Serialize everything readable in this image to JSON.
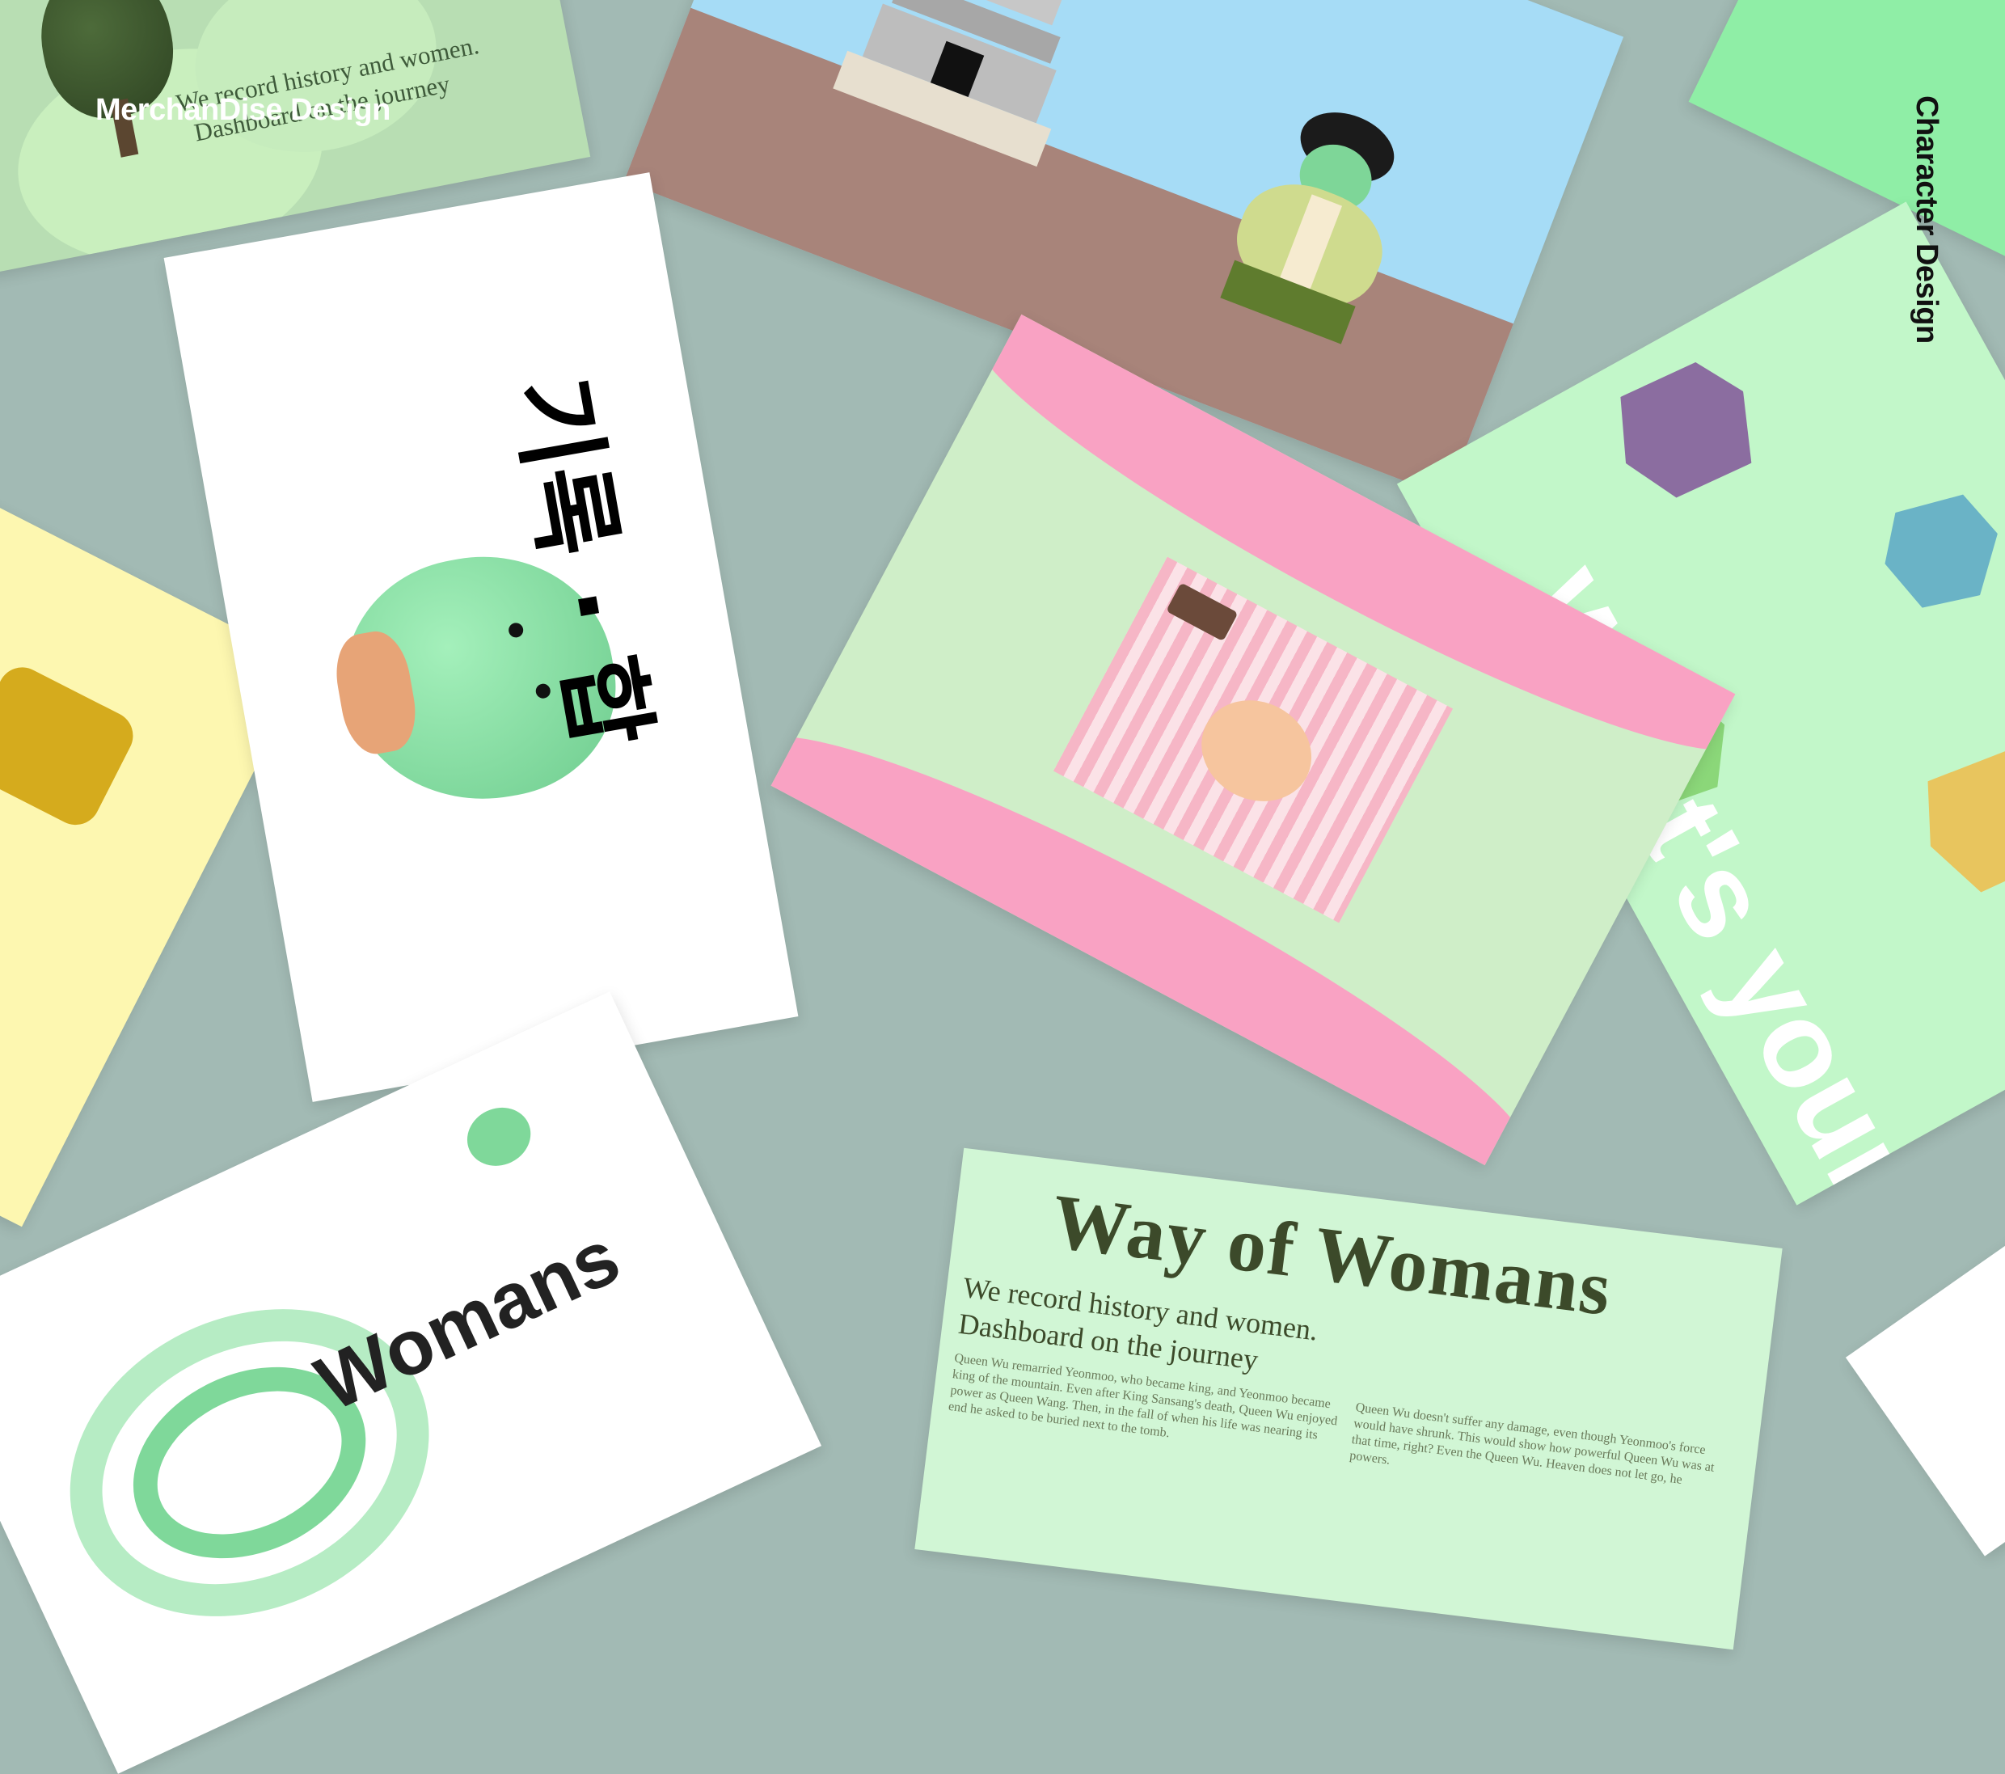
{
  "labels": {
    "merch": "MerchanDise Design",
    "character": "Character Design"
  },
  "top_left_card": {
    "line1": "We record history and women.",
    "line2": "Dashboard on the journey"
  },
  "white_card": {
    "korean_title": "기록 · 합"
  },
  "right_card": {
    "text": "What's your"
  },
  "bottom_card": {
    "title": "Way of Womans",
    "subtitle_1": "We record history and women.",
    "subtitle_2": "Dashboard on the journey",
    "body_left": "Queen Wu remarried Yeonmoo, who became king, and Yeonmoo became king of the mountain. Even after King Sansang's death, Queen Wu enjoyed power as Queen Wang. Then, in the fall of when his life was nearing its end he asked to be buried next to the tomb.",
    "body_right": "Queen Wu doesn't suffer any damage, even though Yeonmoo's force would have shrunk. This would show how powerful Queen Wu was at that time, right? Even the Queen Wu. Heaven does not let go, he powers."
  },
  "bottom_left_card": {
    "text": "Womans"
  },
  "colors": {
    "background": "#a2bab4",
    "mint": "#8de0a6",
    "sky": "#a6dcf6",
    "pink": "#f9a2c3",
    "pale_green": "#cdeeca",
    "yellow": "#fdf7b0",
    "dark_green": "#3c4a2a"
  }
}
